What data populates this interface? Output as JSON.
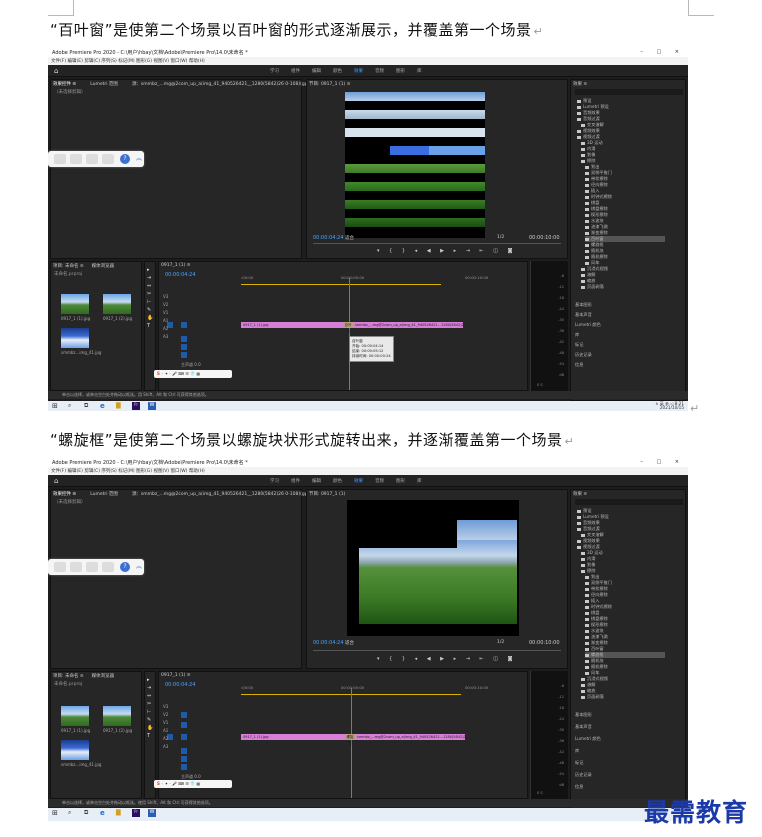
{
  "captions": {
    "first": "“百叶窗”是使第二个场景以百叶窗的形式逐渐展示，并覆盖第一个场景",
    "second": "“螺旋框”是使第二个场景以螺旋块状形式旋转出来，并逐渐覆盖第一个场景",
    "paragraph_mark": "↵"
  },
  "app": {
    "title": "Adobe Premiere Pro 2020 - C:\\用户\\hbay\\文档\\Adobe\\Premiere Pro\\14.0\\未命名 *",
    "window_controls": "–  □  ×",
    "menu": "文件(F)  编辑(E)  剪辑(C)  序列(S)  标记(M)  图形(G)  视图(V)  窗口(W)  帮助(H)",
    "workspaces": [
      "学习",
      "组件",
      "编辑",
      "颜色",
      "效果",
      "音频",
      "图形",
      "库"
    ],
    "active_workspace": "效果"
  },
  "panels": {
    "effect_controls_tab": "效果控件 ≡",
    "lumetri_tab": "Lumetri 范围",
    "source_tab": "源：smmbz_...mg@2com_up_a(img_41_940526421__1280(5842)26 0-108)(gp.info=hkp_...",
    "no_clip": "（未选择剪辑）",
    "program_tab": "节目: 0917_1 (1) ≡",
    "program_tab_short": "节目: 0917_1 (1)",
    "timecode_in": "00:00:04:24",
    "fit": "适合",
    "fraction": "1/2",
    "timecode_out": "00:00:10:00",
    "project_tab": "项目: 未命名 ≡",
    "media_browser_tab": "媒体浏览器",
    "project_file": "未命名.prproj",
    "sequence_tab": "0917_1 (1) ≡",
    "sequence_timecode": "00:00:04:24",
    "ruler_start": ":00:00",
    "ruler_mid": "00:00:05:00",
    "ruler_end": "00:00:10:00",
    "master_track": "主声道",
    "master_value": "0.0",
    "tracks": [
      "V3",
      "V2",
      "V1",
      "A1",
      "A2",
      "A3"
    ],
    "clip_a": "0917_1 (1).jpg",
    "clip_b": "smmbz_...mg@2com_up_a(img_41_940526421...1280(5842)26...",
    "transition_label_1": "百叶窗",
    "transition_label_2": "螺旋框",
    "bin_items": [
      "0917_1 (1).jpg",
      "0917_1 (2).jpg",
      "smmbz...img_41.jpg"
    ],
    "bin_durations": [
      "5:00",
      "5:00",
      "5:00"
    ],
    "meter_labels": [
      "-6",
      "-12",
      "-18",
      "-24",
      "-30",
      "-36",
      "-42",
      "-48",
      "-54",
      "dB"
    ],
    "meter_bottom": "S S"
  },
  "tooltip": {
    "line1": "百叶窗",
    "line2": "开始: 00:00:04:14",
    "line3": "结束: 00:00:05:12",
    "line4": "持续时间: 00:00:00:24"
  },
  "effects": {
    "tab": "效果 ≡",
    "items": [
      "预设",
      "Lumetri 预设",
      "音频效果",
      "音频过渡",
      "交叉溶解",
      "视频效果",
      "视频过渡",
      "3D 运动",
      "内滑",
      "划像",
      "擦除",
      "划出",
      "双侧平推门",
      "带状擦除",
      "径向擦除",
      "插入",
      "时钟式擦除",
      "棋盘",
      "棋盘擦除",
      "楔形擦除",
      "水波块",
      "油漆飞溅",
      "渐变擦除",
      "百叶窗",
      "螺旋框",
      "随机块",
      "随机擦除",
      "风车",
      "沉浸式视频",
      "溶解",
      "缩放",
      "页面剥落"
    ],
    "selected_shot1": "百叶窗",
    "selected_shot2": "螺旋框",
    "bottom": [
      "基本图形",
      "基本声音",
      "Lumetri 颜色",
      "库",
      "标记",
      "历史记录",
      "信息"
    ]
  },
  "status": {
    "shot1": "单击以选择，或单击空白处并拖动以框选。用 Shift、Alt 和 Ctrl 可获得其他选项。",
    "shot2": "单击以选择，或单击空白处并拖动以框选。使用 Shift、Alt 和 Ctrl 可获得其他选项。"
  },
  "taskbar": {
    "time": "8:21",
    "date": "2021/10/15",
    "tray": "∧ 英 ⊕ ◁"
  },
  "watermark": "最需教育",
  "colors": {
    "accent": "#4aa3ff",
    "clip": "#d77ed6",
    "transition": "#b8a07c",
    "watermark": "#1b3aa8",
    "panel_bg": "#262626"
  }
}
